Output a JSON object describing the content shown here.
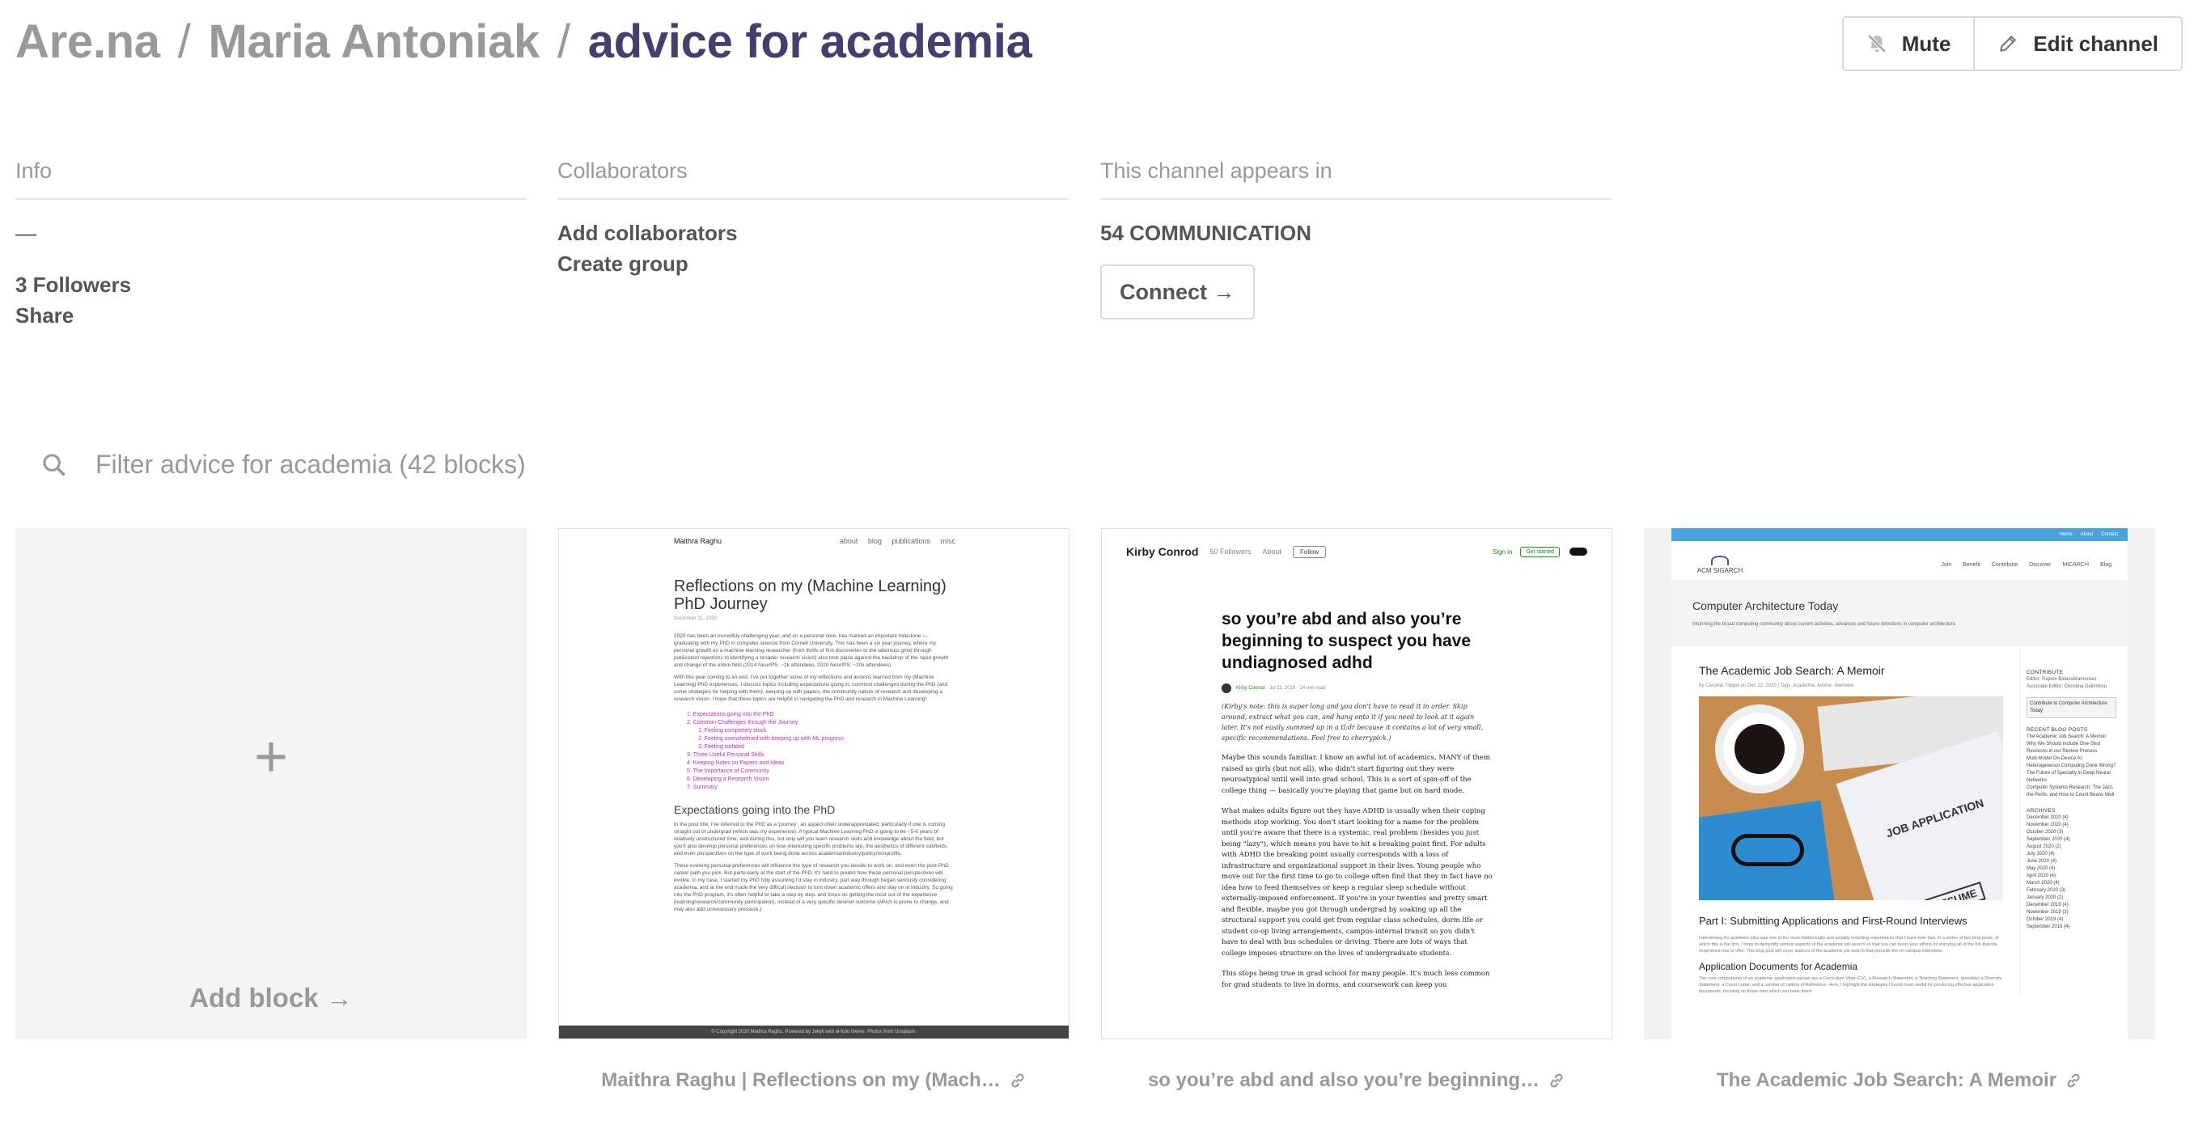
{
  "breadcrumb": {
    "root": "Are.na",
    "user": "Maria Antoniak",
    "channel": "advice for academia",
    "separator": "/"
  },
  "header_actions": {
    "mute_label": "Mute",
    "mute_icon": "muted-bell-icon",
    "edit_label": "Edit channel",
    "edit_icon": "pencil-icon"
  },
  "info": {
    "heading": "Info",
    "description": "—",
    "followers": "3 Followers",
    "share": "Share"
  },
  "collaborators": {
    "heading": "Collaborators",
    "add": "Add collaborators",
    "create_group": "Create group"
  },
  "appears_in": {
    "heading": "This channel appears in",
    "channel": "54 COMMUNICATION",
    "connect": "Connect →"
  },
  "filter": {
    "placeholder": "Filter advice for academia (42 blocks)",
    "icon": "search-icon"
  },
  "add_block": {
    "plus": "+",
    "label": "Add block →"
  },
  "blocks": [
    {
      "caption": "Maithra Raghu | Reflections on my (Mach…",
      "thumb": {
        "brand": "Maithra Raghu",
        "nav": [
          "about",
          "blog",
          "publications",
          "misc"
        ],
        "title": "Reflections on my (Machine Learning) PhD Journey",
        "date": "December 31, 2020",
        "intro": "2020 has been an incredibly challenging year, and on a personal note, has marked an important milestone — graduating with my PhD in computer science from Cornell University. This has been a six year journey, where my personal growth as a machine learning researcher (from thrills of first discoveries to the laborious grind through publication rejections to identifying a broader research vision) also took place against the backdrop of the rapid growth and change of the entire field (2014 NeurIPS: ~2k attendees, 2020 NeurIPS: ~20k attendees).",
        "intro2": "With this year coming to an end, I've put together some of my reflections and lessons learned from my (Machine Learning) PhD experiences. I discuss topics including expectations going in, common challenges during the PhD (and some strategies for helping with them), keeping up with papers, the community nature of research and developing a research vision. I hope that these topics are helpful in navigating the PhD and research in Machine Learning!",
        "toc": [
          "1. Expectations going into the PhD",
          "2. Common Challenges through the Journey",
          "1. Feeling completely stuck",
          "2. Feeling overwhelmed with keeping up with ML progress",
          "3. Feeling isolated",
          "3. Three Useful Personal Skills",
          "4. Keeping Notes on Papers and Ideas",
          "5. The Importance of Community",
          "6. Developing a Research Vision",
          "7. Summary"
        ],
        "section": "Expectations going into the PhD",
        "body": "In the post title, I've referred to the PhD as a 'journey', an aspect often underappreciated, particularly if one is coming straight out of undergrad (which was my experience). A typical Machine Learning PhD is going to be ~5-6 years of relatively unstructured time, and during this, not only will you learn research skills and knowledge about the field, but you'll also develop personal preferences on how interesting specific problems are, the aesthetics of different subfields, and even perspectives on the type of work being done across academia/industry/policy/nonprofits.",
        "body2": "These evolving personal preferences will influence the type of research you decide to work on, and even the post-PhD career path you pick. But particularly at the start of the PhD, it's hard to predict how these personal perspectives will evolve. In my case, I started my PhD fully assuming I'd stay in industry, part way through began seriously considering academia, and at the end made the very difficult decision to turn down academic offers and stay on in industry. So going into the PhD program, it's often helpful to take a step by step, and focus on getting the most out of the experience (learning/research/community participation), instead of a very specific desired outcome (which is prone to change, and may also add unnecessary pressure.)",
        "footer": "© Copyright 2020 Maithra Raghu. Powered by Jekyll with al-folio theme. Photos from Unsplash."
      }
    },
    {
      "caption": "so you’re abd and also you’re beginning…",
      "thumb": {
        "brand": "Kirby Conrod",
        "followers": "50 Followers",
        "about": "About",
        "follow": "Follow",
        "sign_in": "Sign in",
        "get_started": "Get started",
        "title": "so you’re abd and also you’re beginning to suspect you have undiagnosed adhd",
        "author": "Kirby Conrod",
        "meta": "Jul 11, 2019 · 24 min read",
        "note": "(Kirby's note: this is super long and you don't have to read it in order. Skip around, extract what you can, and hang onto it if you need to look at it again later. It's not easily summed up in a tl;dr because it contains a lot of very small, specific recommendations. Feel free to cherrypick.)",
        "p1": "Maybe this sounds familiar. I know an awful lot of academics, MANY of them raised as girls (but not all), who didn't start figuring out they were neuroatypical until well into grad school. This is a sort of spin-off of the college thing — basically you're playing that game but on hard mode.",
        "p2": "What makes adults figure out they have ADHD is usually when their coping methods stop working. You don't start looking for a name for the problem until you're aware that there is a systemic, real problem (besides you just being \"lazy\"), which means you have to hit a breaking point first. For adults with ADHD the breaking point usually corresponds with a loss of infrastructure and organizational support in their lives. Young people who move out for the first time to go to college often find that they in fact have no idea how to feed themselves or keep a regular sleep schedule without externally-imposed enforcement. If you're in your twenties and pretty smart and flexible, maybe you got through undergrad by soaking up all the structural support you could get from regular class schedules, dorm life or student co-op living arrangements, campus-internal transit so you didn't have to deal with bus schedules or driving. There are lots of ways that college imposes structure on the lives of undergraduate students.",
        "p3": "This stops being true in grad school for many people. It's much less common for grad students to live in dorms, and coursework can keep you"
      }
    },
    {
      "caption": "The Academic Job Search: A Memoir",
      "thumb": {
        "topbar": [
          "Home",
          "About",
          "Contact"
        ],
        "logo": "ACM SIGARCH",
        "menu": [
          "Join",
          "Benefit",
          "Contribute",
          "Discover",
          "MICARCH",
          "Blog"
        ],
        "band_title": "Computer Architecture Today",
        "band_sub": "Informing the broad computing community about current activities, advances and future directions in computer architecture.",
        "title": "The Academic Job Search: A Memoir",
        "byline": "by Caroline Trippel on Dec 22, 2020 | Tags: Academia, Advice, Interview",
        "paper_label": "JOB APPLICATION",
        "resume_label": "RESUME",
        "h2": "Part I: Submitting Applications and First-Round Interviews",
        "p": "Interviewing for academic jobs was one of the most intellectually and socially enriching experiences that I have ever had. In a series of two blog posts, of which this is the first, I hope to demystify various aspects of the academic job search so that you can focus your efforts on enjoying all of the fun that the experience has to offer. This blog post will cover aspects of the academic job search that precede the on-campus interviews.",
        "h3": "Application Documents for Academia",
        "p2": "The core components of an academic application packet are a Curriculum Vitae (CV), a Research Statement, a Teaching Statement, (possibly) a Diversity Statement, a Cover Letter, and a number of Letters of Reference. Here, I highlight the strategies I found most useful for producing effective application documents, focusing on those over which you have direct",
        "side_contribute": "CONTRIBUTE",
        "side_editors": "Editor: Rajeev Balasubramonian · Associate Editor: Christina Delimitrou",
        "side_button": "Contribute to Computer Architecture Today",
        "side_recent": "RECENT BLOG POSTS",
        "side_posts": [
          "The Academic Job Search: A Memoir",
          "Why We Should Include One-Shot Revisions in our Review Process",
          "Multi-Model On-Device AI: Heterogeneous Computing Done Wrong?",
          "The Future of Specialty in Deep Neural Networks",
          "Computer Systems Research: The Jazz, the Perils, and How to Count Beans Well"
        ],
        "side_archives": "ARCHIVES",
        "side_months": [
          "December 2020 (4)",
          "November 2020 (4)",
          "October 2020 (3)",
          "September 2020 (4)",
          "August 2020 (2)",
          "July 2020 (4)",
          "June 2020 (4)",
          "May 2020 (4)",
          "April 2020 (4)",
          "March 2020 (4)",
          "February 2020 (3)",
          "January 2020 (2)",
          "December 2019 (4)",
          "November 2019 (3)",
          "October 2019 (4)",
          "September 2019 (4)"
        ]
      }
    }
  ]
}
